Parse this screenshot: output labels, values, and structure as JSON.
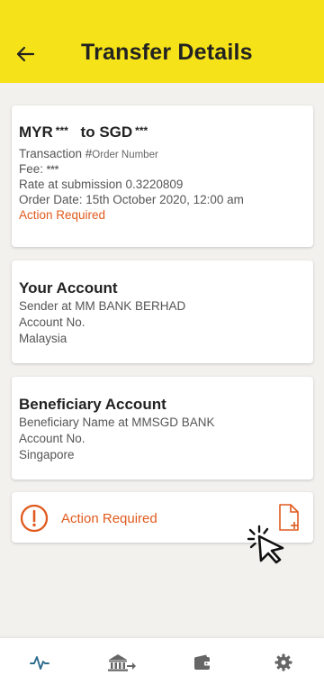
{
  "header": {
    "title": "Transfer Details",
    "back_icon": "arrow-left-icon"
  },
  "transfer": {
    "from_currency": "MYR",
    "from_masked": "***",
    "to_prefix": "to",
    "to_currency": "SGD",
    "to_masked": "***",
    "transaction_label": "Transaction #",
    "transaction_value": "Order Number",
    "fee_label": "Fee:",
    "fee_masked": "***",
    "rate": "Rate at submission 0.3220809",
    "order_date": "Order Date: 15th October 2020, 12:00 am",
    "status": "Action Required"
  },
  "your_account": {
    "title": "Your Account",
    "sender": "Sender at MM BANK BERHAD",
    "account_no": "Account No.",
    "country": "Malaysia"
  },
  "beneficiary_account": {
    "title": "Beneficiary Account",
    "name": "Beneficiary Name at MMSGD BANK",
    "account_no": "Account No.",
    "country": "Singapore"
  },
  "action_card": {
    "label": "Action Required",
    "alert_icon": "alert-circle-icon",
    "upload_icon": "file-add-icon"
  },
  "bottom_nav": [
    {
      "icon": "activity-icon",
      "active": true
    },
    {
      "icon": "bank-transfer-icon",
      "active": false
    },
    {
      "icon": "wallet-icon",
      "active": false
    },
    {
      "icon": "settings-icon",
      "active": false
    }
  ],
  "colors": {
    "header_bg": "#f5e218",
    "accent_orange": "#e05a1e",
    "nav_active": "#2d6b8c",
    "nav_inactive": "#666666"
  }
}
